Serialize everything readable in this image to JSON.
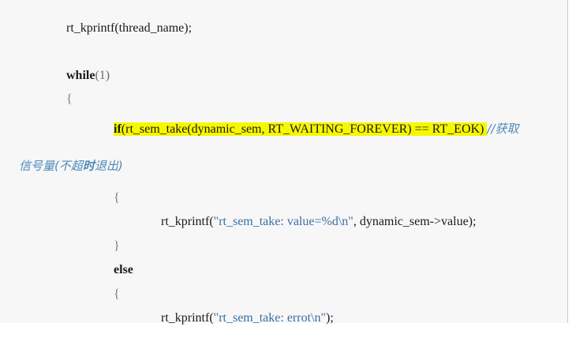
{
  "code": {
    "line1": "rt_kprintf(thread_name);",
    "line2_kw": "while",
    "line2_arg": "(1)",
    "line3_brace": "{",
    "line4_kw": "if",
    "line4_body": "(rt_sem_take(dynamic_sem, RT_WAITING_FOREVER) == RT_EOK) ",
    "line4_comment": "//获取",
    "line5_comment_a": "信号量(不超",
    "line5_comment_b": "时",
    "line5_comment_c": "退出)",
    "line6_brace": "{",
    "line7_pre": "rt_kprintf(",
    "line7_str": "\"rt_sem_take: value=%d",
    "line7_esc": "\\n",
    "line7_strend": "\"",
    "line7_post": ", dynamic_sem->value);",
    "line8_brace": "}",
    "line9_kw": "else",
    "line10_brace": "{",
    "line11_pre": "rt_kprintf(",
    "line11_str": "\"rt_sem_take: errot",
    "line11_esc": "\\n",
    "line11_strend": "\"",
    "line11_post": ");"
  }
}
